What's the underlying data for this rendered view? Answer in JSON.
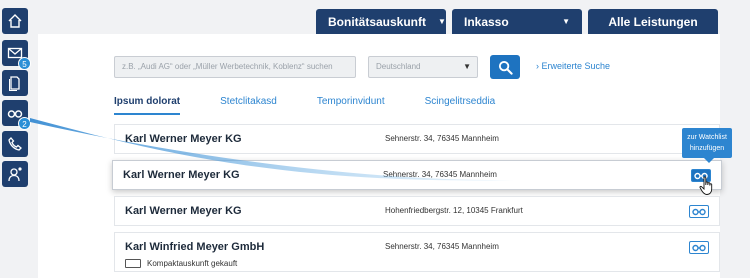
{
  "sidebar": {
    "items": [
      {
        "icon": "home-icon"
      },
      {
        "icon": "mail-icon",
        "badge": "5"
      },
      {
        "icon": "document-icon"
      },
      {
        "icon": "binoculars-icon",
        "badge": "2"
      },
      {
        "icon": "phone-icon"
      },
      {
        "icon": "user-settings-icon"
      }
    ]
  },
  "topnav": {
    "tabs": [
      {
        "label": "Bonitätsauskunft",
        "caret": "▼"
      },
      {
        "label": "Inkasso",
        "caret": "▼"
      },
      {
        "label": "Alle Leistungen"
      }
    ]
  },
  "search": {
    "placeholder": "z.B. „Audi AG“ oder „Müller Werbetechnik, Koblenz“ suchen",
    "country": "Deutschland",
    "country_caret": "▼",
    "advanced_label": "› Erweiterte Suche"
  },
  "result_tabs": [
    "Ipsum dolorat",
    "Stetclitakasd",
    "Temporinvidunt",
    "Scingelitrseddia"
  ],
  "results": [
    {
      "company": "Karl Werner Meyer KG",
      "address": "Sehnerstr. 34, 76345 Mannheim"
    },
    {
      "company": "Karl Werner Meyer KG",
      "address": "Sehnerstr. 34, 76345 Mannheim"
    },
    {
      "company": "Karl Werner Meyer KG",
      "address": "Hohenfriedbergstr. 12, 10345 Frankfurt"
    },
    {
      "company": "Karl Winfried Meyer GmbH",
      "address": "Sehnerstr. 34, 76345 Mannheim",
      "subline": "Kompaktauskunft gekauft"
    }
  ],
  "tooltip": {
    "line1": "zur Watchlist",
    "line2": "hinzufügen"
  },
  "colors": {
    "navy": "#1f3f6e",
    "accent": "#2d85d0",
    "button": "#1e73c0"
  }
}
